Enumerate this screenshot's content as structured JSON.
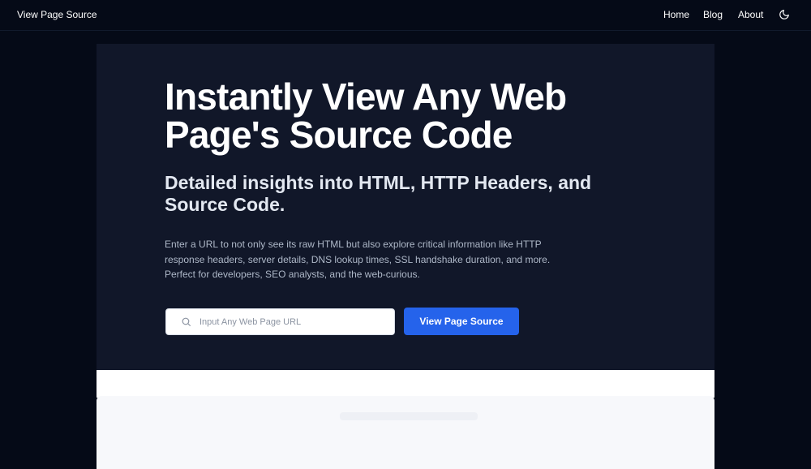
{
  "header": {
    "brand": "View Page Source",
    "nav": {
      "home": "Home",
      "blog": "Blog",
      "about": "About"
    },
    "theme_icon": "moon-icon"
  },
  "hero": {
    "headline": "Instantly View Any Web Page's Source Code",
    "subheadline": "Detailed insights into HTML, HTTP Headers, and Source Code.",
    "description": "Enter a URL to not only see its raw HTML but also explore critical information like HTTP response headers, server details, DNS lookup times, SSL handshake duration, and more. Perfect for developers, SEO analysts, and the web-curious.",
    "search": {
      "icon": "search-icon",
      "placeholder": "Input Any Web Page URL",
      "value": ""
    },
    "submit_label": "View Page Source"
  },
  "colors": {
    "page_bg": "#050a17",
    "hero_bg": "#111729",
    "accent": "#2563eb"
  }
}
